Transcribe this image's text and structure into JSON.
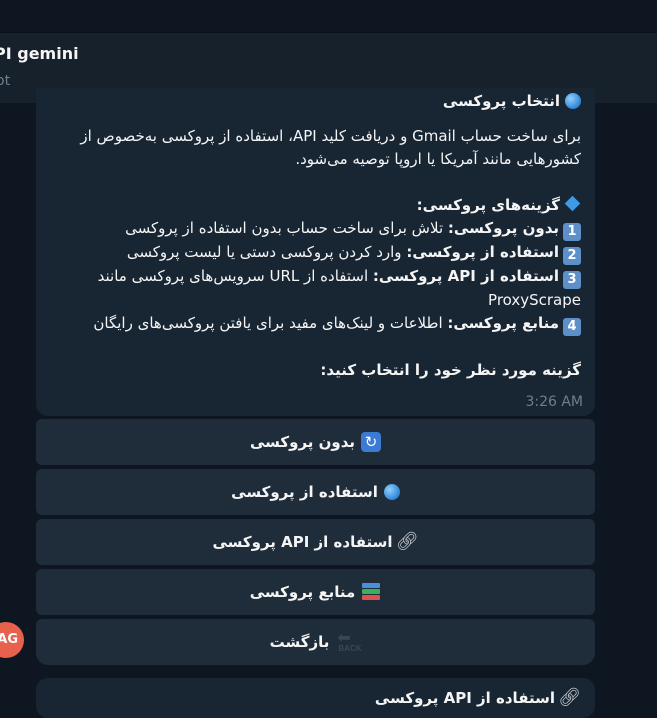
{
  "header": {
    "title": "PI gemini",
    "subtitle": "ot"
  },
  "message": {
    "heading": "انتخاب پروکسی",
    "intro_line1": "برای ساخت حساب Gmail و دریافت کلید API، استفاده از پروکسی به‌خصوص از",
    "intro_line2": "کشورهایی مانند آمریکا یا اروپا توصیه می‌شود.",
    "options_title": "گزینه‌های پروکسی:",
    "options": [
      {
        "key": "1",
        "label": "بدون پروکسی:",
        "desc": "تلاش برای ساخت حساب بدون استفاده از پروکسی"
      },
      {
        "key": "2",
        "label": "استفاده از پروکسی:",
        "desc": "وارد کردن پروکسی دستی یا لیست پروکسی"
      },
      {
        "key": "3",
        "label": "استفاده از API پروکسی:",
        "desc": "استفاده از URL سرویس‌های پروکسی مانند",
        "desc_cont": "ProxyScrape"
      },
      {
        "key": "4",
        "label": "منابع پروکسی:",
        "desc": "اطلاعات و لینک‌های مفید برای یافتن پروکسی‌های رایگان"
      }
    ],
    "prompt": "گزینه مورد نظر خود را انتخاب کنید:",
    "time": "3:26 AM"
  },
  "keyboard": [
    {
      "label": "بدون پروکسی",
      "icon": "refresh-icon"
    },
    {
      "label": "استفاده از پروکسی",
      "icon": "globe-icon"
    },
    {
      "label": "استفاده از API پروکسی",
      "icon": "link-icon"
    },
    {
      "label": "منابع پروکسی",
      "icon": "books-icon"
    },
    {
      "label": "بازگشت",
      "icon": "back-icon",
      "icon_text": "BACK"
    }
  ],
  "avatar": {
    "initials": "AG",
    "color": "#e7614d"
  },
  "next_message": {
    "text": "استفاده از API پروکسی",
    "icon": "link-icon"
  },
  "colors": {
    "background": "#0e1621",
    "header": "#17212b",
    "bubble": "#182533",
    "button": "#1f2c3a",
    "muted_text": "#6d7f8f",
    "keycap": "#5d8fc9"
  }
}
